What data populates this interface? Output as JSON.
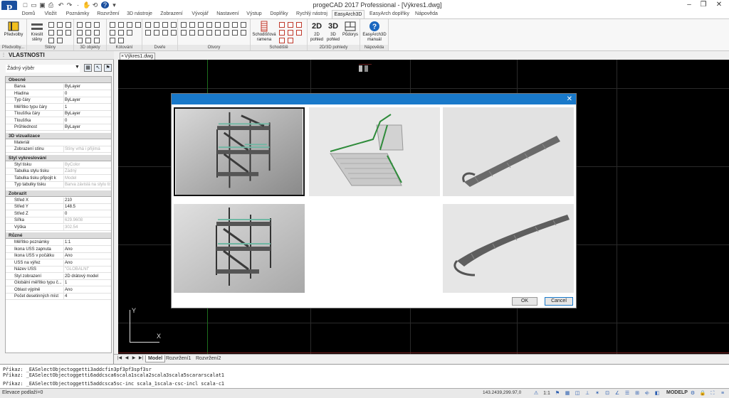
{
  "titlebar": {
    "title": "progeCAD 2017 Professional - [Výkres1.dwg]",
    "logo_letter": "P",
    "qa_icons": [
      "new-icon",
      "open-icon",
      "save-icon",
      "print-icon",
      "undo-icon",
      "redo-icon",
      "help-icon"
    ]
  },
  "menu_tabs": [
    "Domů",
    "Vložit",
    "Poznámky",
    "Rozvržení",
    "3D nástroje",
    "Zobrazení",
    "Vývojář",
    "Nastavení",
    "Výstup",
    "Doplňky",
    "Rychlý nástroj",
    "EasyArch3D",
    "EasyArch doplňky",
    "Nápověda"
  ],
  "ribbon": {
    "groups": [
      {
        "label": "Předvolby...",
        "buttons": [
          "Předvolby"
        ]
      },
      {
        "label": "Stěny",
        "buttons": [
          "Kreslit stěny"
        ]
      },
      {
        "label": "3D objekty",
        "buttons": []
      },
      {
        "label": "Kótování",
        "buttons": []
      },
      {
        "label": "Dveře",
        "buttons": []
      },
      {
        "label": "Otvory",
        "buttons": []
      },
      {
        "label": "Schodiště",
        "buttons": [
          "Schodišťová ramena"
        ]
      },
      {
        "label": "2D/3D pohledy",
        "buttons": [
          "2D pohled",
          "3D pohled",
          "Půdorys"
        ]
      },
      {
        "label": "Nápověda",
        "buttons": [
          "EasyArch3D manuál"
        ]
      }
    ],
    "view_2d": "2D",
    "view_3d": "3D"
  },
  "properties": {
    "title": "VLASTNOSTI",
    "selection": "Žádný výběr",
    "sections": [
      {
        "name": "Obecné",
        "rows": [
          [
            "Barva",
            "ByLayer"
          ],
          [
            "Hladina",
            "0"
          ],
          [
            "Typ čáry",
            "ByLayer"
          ],
          [
            "Měřítko typu čáry",
            "1"
          ],
          [
            "Tloušťka čáry",
            "ByLayer"
          ],
          [
            "Tloušťka",
            "0"
          ],
          [
            "Průhlednost",
            "ByLayer"
          ]
        ]
      },
      {
        "name": "3D vizualizace",
        "rows": [
          [
            "Materiál",
            ""
          ],
          [
            "Zobrazení stínu",
            "Stíny vrhá i přijímá"
          ]
        ]
      },
      {
        "name": "Styl vykreslování",
        "rows": [
          [
            "Styl tisku",
            "ByColor"
          ],
          [
            "Tabulka stylu tisku",
            "Žádný"
          ],
          [
            "Tabulka tisku připojit k",
            "Model"
          ],
          [
            "Typ tabulky tisku",
            "Barva závislá na stylu tis"
          ]
        ]
      },
      {
        "name": "Zobrazit",
        "rows": [
          [
            "Střed X",
            "210"
          ],
          [
            "Střed Y",
            "148.5"
          ],
          [
            "Střed Z",
            "0"
          ],
          [
            "Šířka",
            "629.9608"
          ],
          [
            "Výška",
            "302.54"
          ]
        ]
      },
      {
        "name": "Různé",
        "rows": [
          [
            "Měřítko poznámky",
            "1:1"
          ],
          [
            "Ikona USS zapnuta",
            "Ano"
          ],
          [
            "Ikona USS v počátku",
            "Ano"
          ],
          [
            "USS na výřez",
            "Ano"
          ],
          [
            "Název USS",
            "\"GLOBÁLNÍ\""
          ],
          [
            "Styl zobrazení",
            "2D drátový model"
          ],
          [
            "Globální měřítko typu č...",
            "1"
          ],
          [
            "Oblast výplně",
            "Ano"
          ],
          [
            "Počet desetinných míst",
            "4"
          ]
        ]
      }
    ],
    "dim_values": [
      "Stíny vrhá i přijímá",
      "ByColor",
      "Žádný",
      "Model",
      "Barva závislá na stylu tis",
      "629.9608",
      "302.54",
      "\"GLOBÁLNÍ\""
    ]
  },
  "document_tab": "Výkres1.dwg",
  "ucs": {
    "x": "X",
    "y": "Y"
  },
  "dialog": {
    "ok": "OK",
    "cancel": "Cancel",
    "thumbnails": [
      "staircase-spiral-platforms",
      "staircase-u-turn-green-rail",
      "staircase-curved-concrete",
      "staircase-spiral-platforms-alt",
      "",
      "staircase-curved-concrete-alt"
    ],
    "selected_index": 0
  },
  "layout_tabs": [
    "Model",
    "Rozvržení1",
    "Rozvržení2"
  ],
  "command": {
    "history": [
      "Příkaz: _EASelectObjectoggetti3addcfin3pf3pf3spf3sr",
      "Příkaz: _EASelectObjectoggetti6addcsca6scala1scala2scala3scala5scararscalat1"
    ],
    "prompt": "Příkaz: _EASelectObjectoggetti5addcsca5sc-inc scala_1scala-csc-incl scala-c1"
  },
  "status": {
    "left": "Elevace podlaží=0",
    "coords": "143.2439,299.97,0",
    "scale": "1:1",
    "mode": "MODELP"
  }
}
